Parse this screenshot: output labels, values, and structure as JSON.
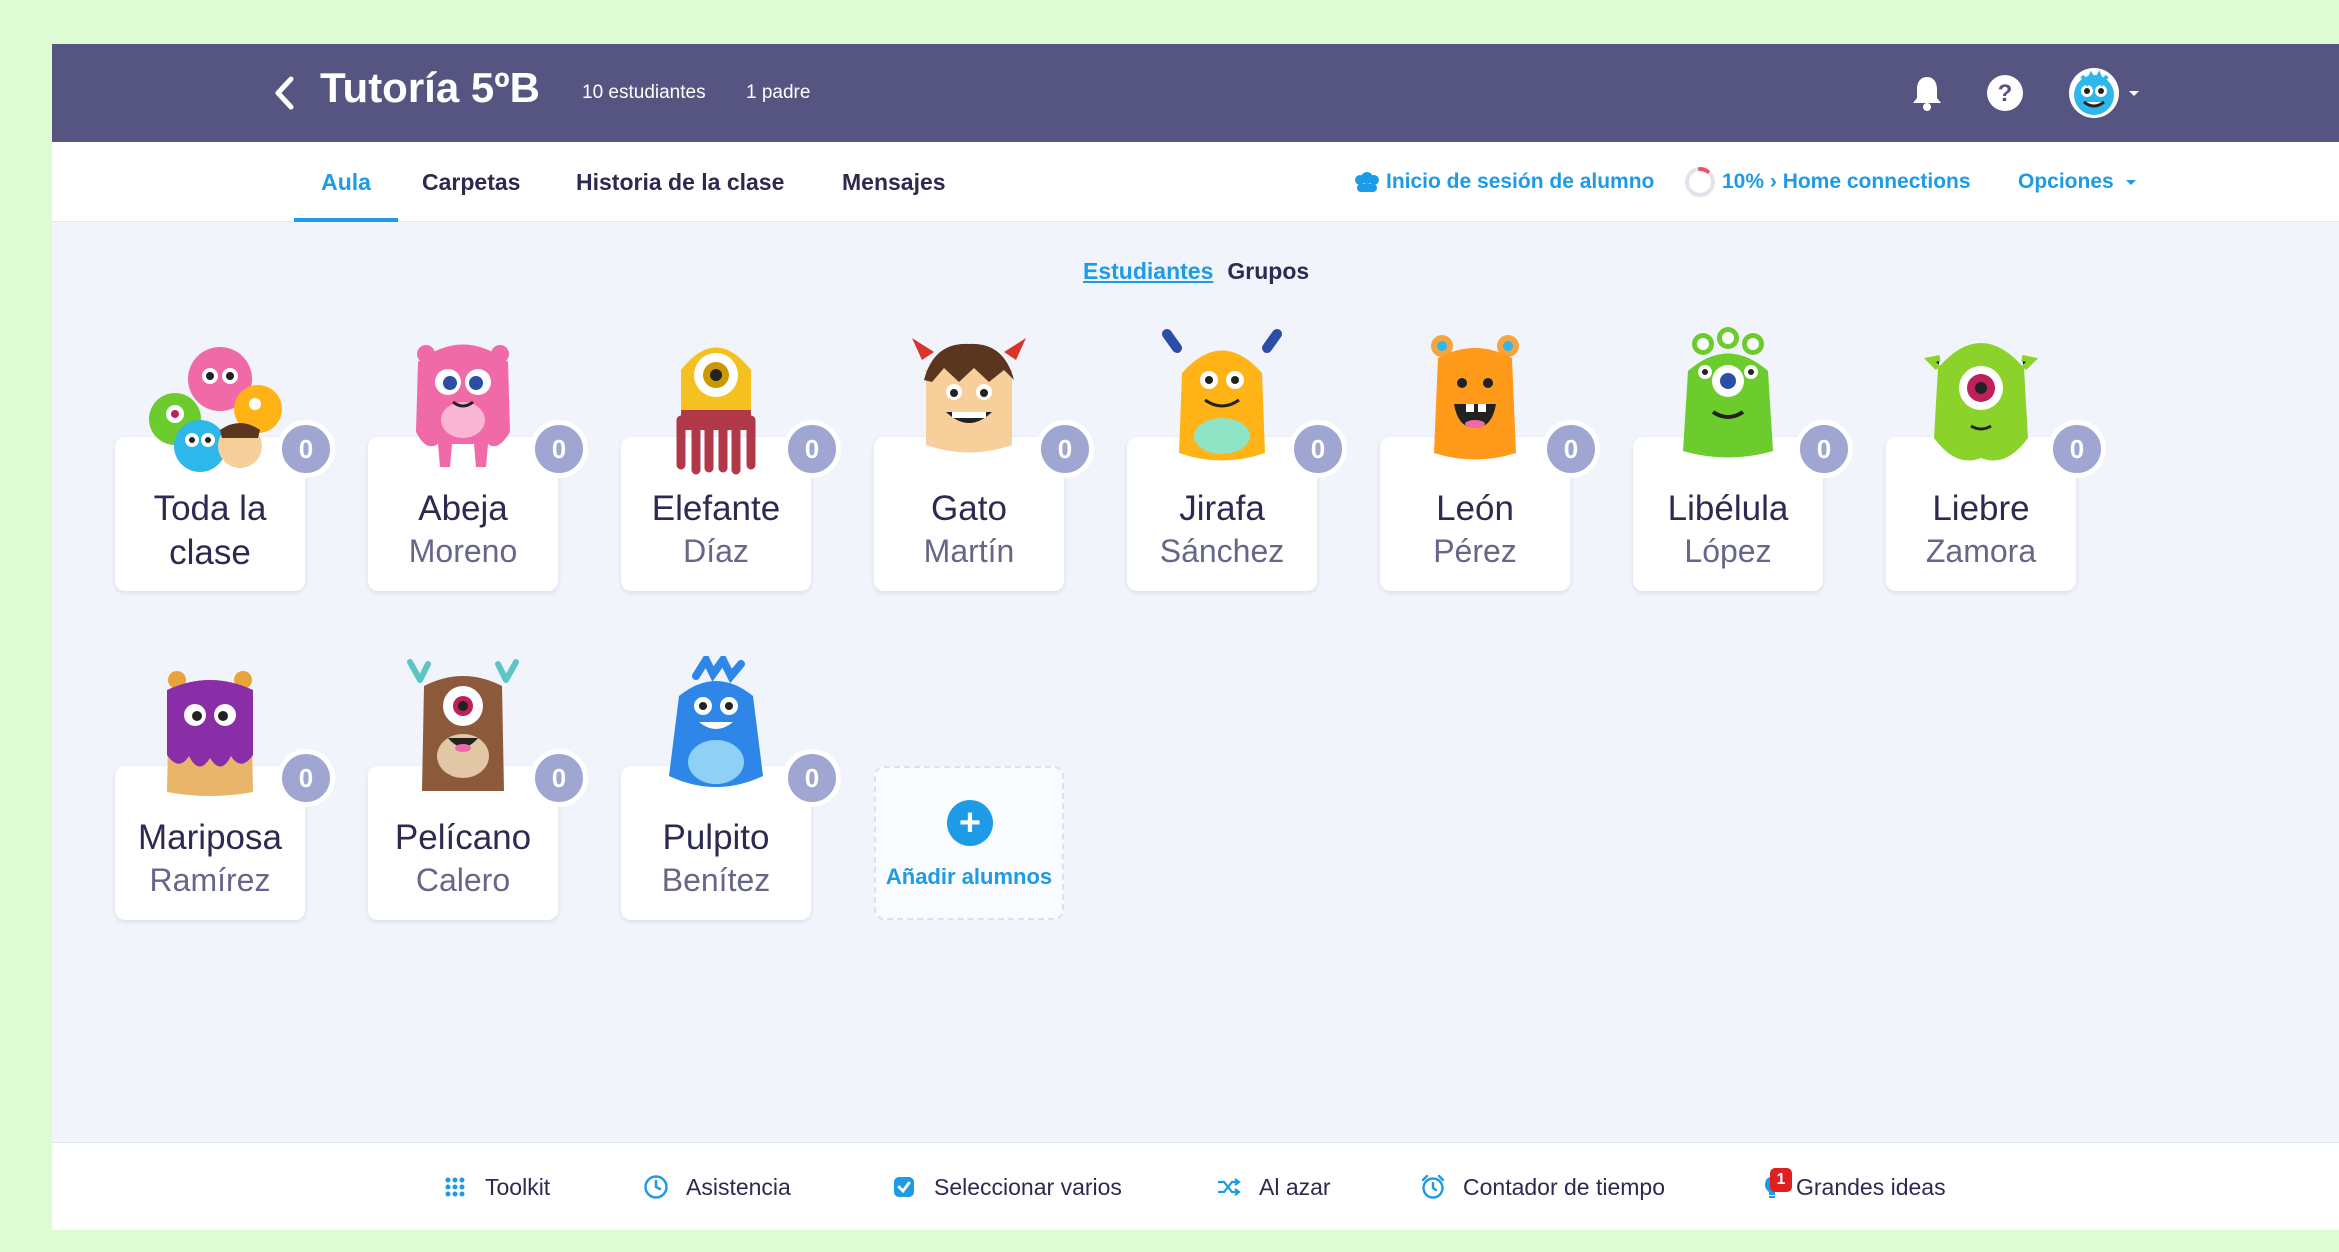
{
  "header": {
    "title": "Tutoría 5ºB",
    "students_count": "10 estudiantes",
    "parents_count": "1 padre",
    "bell_icon": "bell-icon",
    "help_icon": "help-icon"
  },
  "nav": {
    "tabs": [
      {
        "label": "Aula",
        "active": true
      },
      {
        "label": "Carpetas"
      },
      {
        "label": "Historia de la clase"
      },
      {
        "label": "Mensajes"
      }
    ],
    "student_login": "Inicio de sesión de alumno",
    "home_connections": "10% › Home connections",
    "options": "Opciones",
    "home_connections_progress": 0.1
  },
  "view_toggle": {
    "students": "Estudiantes",
    "groups": "Grupos"
  },
  "whole_class": {
    "line1": "Toda la",
    "line2": "clase",
    "points": "0"
  },
  "students": [
    {
      "first": "Abeja",
      "last": "Moreno",
      "points": "0",
      "color": "#f06aa8"
    },
    {
      "first": "Elefante",
      "last": "Díaz",
      "points": "0",
      "color": "#f5c121"
    },
    {
      "first": "Gato",
      "last": "Martín",
      "points": "0",
      "color": "#f6cf9a"
    },
    {
      "first": "Jirafa",
      "last": "Sánchez",
      "points": "0",
      "color": "#ffb316"
    },
    {
      "first": "León",
      "last": "Pérez",
      "points": "0",
      "color": "#ff9a1a"
    },
    {
      "first": "Libélula",
      "last": "López",
      "points": "0",
      "color": "#6ccb2d"
    },
    {
      "first": "Liebre",
      "last": "Zamora",
      "points": "0",
      "color": "#8bd32b"
    },
    {
      "first": "Mariposa",
      "last": "Ramírez",
      "points": "0",
      "color": "#8a2ea8"
    },
    {
      "first": "Pelícano",
      "last": "Calero",
      "points": "0",
      "color": "#8c5a3a"
    },
    {
      "first": "Pulpito",
      "last": "Benítez",
      "points": "0",
      "color": "#2e86e8"
    }
  ],
  "add_students": "Añadir alumnos",
  "toolbar": {
    "toolkit": "Toolkit",
    "attendance": "Asistencia",
    "select_multiple": "Seleccionar varios",
    "random": "Al azar",
    "timer": "Contador de tiempo",
    "big_ideas": "Grandes ideas",
    "big_ideas_badge": "1"
  },
  "colors": {
    "header_bg": "#565582",
    "accent": "#1e9be6",
    "badge": "#9fa6d1",
    "page_border": "#dffbd3"
  }
}
